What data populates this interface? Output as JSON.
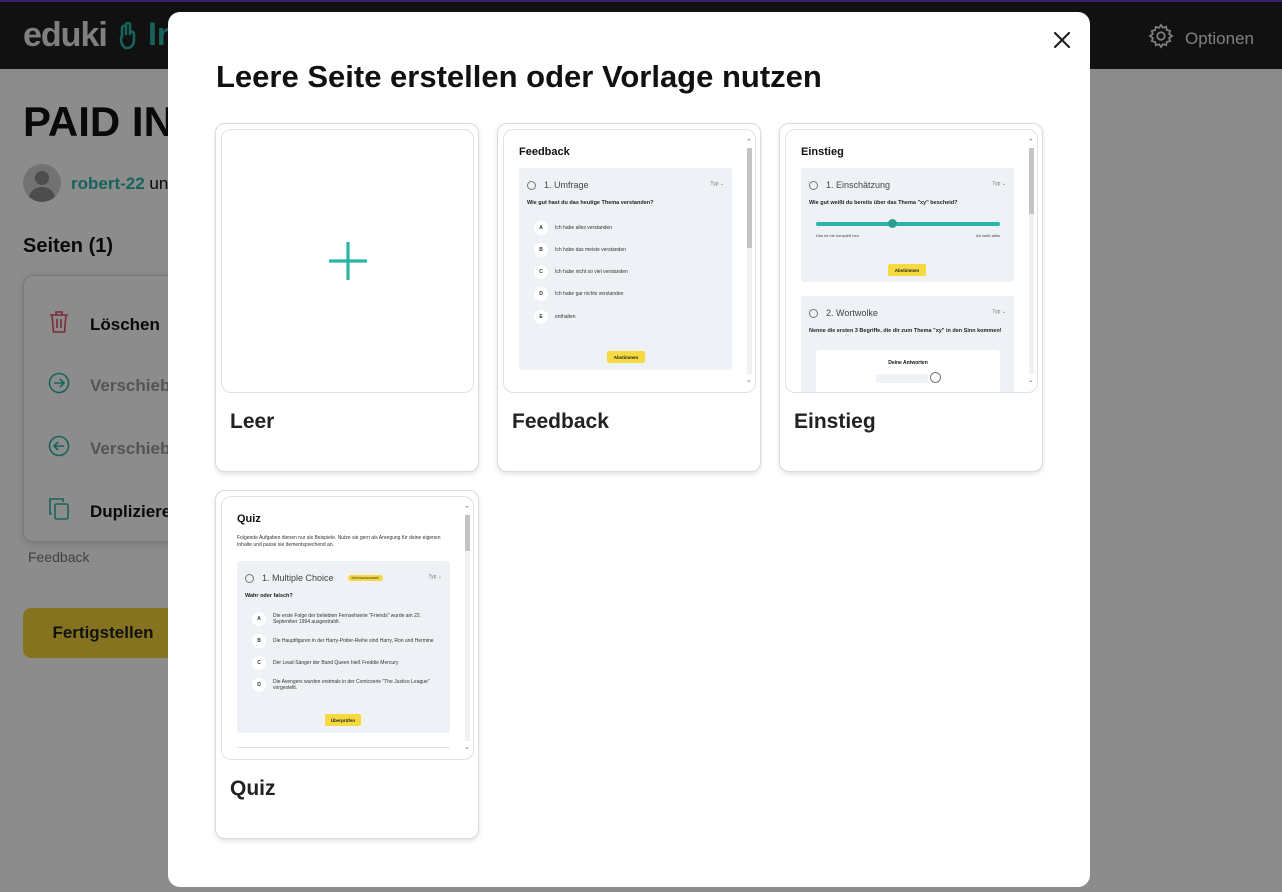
{
  "app": {
    "logo_text": "eduki",
    "logo_suffix": "In",
    "options_label": "Optionen"
  },
  "page": {
    "title": "PAID IN",
    "author_name": "robert-22",
    "author_suffix": " un",
    "pages_heading": "Seiten (1)",
    "page_label": "Feedback",
    "finish_label": "Fertigstellen"
  },
  "context_menu": {
    "items": [
      {
        "label": "Löschen",
        "icon": "trash-icon",
        "enabled": true
      },
      {
        "label": "Verschiebe",
        "icon": "arrow-right-circle-icon",
        "enabled": false
      },
      {
        "label": "Verschiebe",
        "icon": "arrow-left-circle-icon",
        "enabled": false
      },
      {
        "label": "Duplizieren",
        "icon": "duplicate-icon",
        "enabled": true
      }
    ]
  },
  "modal": {
    "title": "Leere Seite erstellen oder Vorlage nutzen",
    "close_icon": "close-icon",
    "templates": [
      {
        "label": "Leer",
        "preview": "plus-icon"
      },
      {
        "label": "Feedback",
        "preview": {
          "title": "Feedback",
          "question_title": "1. Umfrage",
          "typ_label": "Typ",
          "question": "Wie gut hast du das heutige Thema verstanden?",
          "answers": [
            {
              "letter": "A",
              "text": "Ich habe alles verstanden"
            },
            {
              "letter": "B",
              "text": "Ich habe das meiste verstanden"
            },
            {
              "letter": "C",
              "text": "Ich habe nicht so viel verstanden"
            },
            {
              "letter": "D",
              "text": "Ich habe gar nichts verstanden"
            },
            {
              "letter": "E",
              "text": "enthalten"
            }
          ],
          "button": "Abstimmen"
        }
      },
      {
        "label": "Einstieg",
        "preview": {
          "title": "Einstieg",
          "q1_title": "1. Einschätzung",
          "typ_label": "Typ",
          "q1_question": "Wie gut weißt du bereits über das Thema \"xy\" bescheid?",
          "slider_left": "Das ist mir komplett neu",
          "slider_right": "Ich weiß alles",
          "button": "Abstimmen",
          "q2_title": "2. Wortwolke",
          "q2_question": "Nenne die ersten 3 Begriffe, die dir zum Thema \"xy\" in den Sinn kommen!",
          "answers_label": "Deine Antworten"
        }
      },
      {
        "label": "Quiz",
        "preview": {
          "title": "Quiz",
          "intro": "Folgende Aufgaben dienen nur als Beispiele. Nutze sie gern als Anregung für deine eigenen Inhalte und passe sie dementsprechend an.",
          "question_title": "1. Multiple Choice",
          "badge": "Mehrfachauswahl",
          "typ_label": "Typ",
          "question": "Wahr oder falsch?",
          "answers": [
            {
              "letter": "A",
              "text": "Die erste Folge der beliebten Fernsehserie \"Friends\" wurde am 22. September 1994 ausgestrahlt."
            },
            {
              "letter": "B",
              "text": "Die Hauptfiguren in der Harry-Potter-Reihe sind Harry, Ron und Hermine"
            },
            {
              "letter": "C",
              "text": "Der Lead-Sänger der Band Queen hieß Freddie Mercury"
            },
            {
              "letter": "D",
              "text": "Die Avengers wurden erstmals in der Comicserie \"The Justice League\" vorgestellt."
            }
          ],
          "button": "Überprüfen"
        }
      }
    ]
  }
}
